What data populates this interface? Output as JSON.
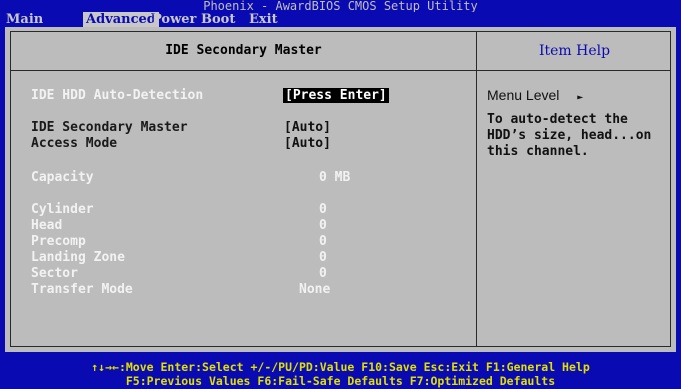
{
  "title": "Phoenix - AwardBIOS CMOS Setup Utility",
  "menu": [
    "Main",
    "Advanced",
    "Power",
    "Boot",
    "Exit"
  ],
  "panel_title": "IDE Secondary Master",
  "help_title": "Item Help",
  "fields": {
    "auto_detect": {
      "label": "IDE HDD Auto-Detection",
      "value": "[Press Enter]"
    },
    "secondary_master": {
      "label": "IDE Secondary Master",
      "value": "[Auto]"
    },
    "access_mode": {
      "label": "Access Mode",
      "value": "[Auto]"
    },
    "capacity": {
      "label": "Capacity",
      "value": "0 MB"
    },
    "cylinder": {
      "label": "Cylinder",
      "value": "0"
    },
    "head": {
      "label": "Head",
      "value": "0"
    },
    "precomp": {
      "label": "Precomp",
      "value": "0"
    },
    "landing_zone": {
      "label": "Landing Zone",
      "value": "0"
    },
    "sector": {
      "label": "Sector",
      "value": "0"
    },
    "transfer_mode": {
      "label": "Transfer Mode",
      "value": "None"
    }
  },
  "help": {
    "menu_level": "Menu Level",
    "menu_level_arrow": "►",
    "line1": "To auto-detect the",
    "line2": "HDD’s size, head...on",
    "line3": "this channel."
  },
  "footer": {
    "line1": "↑↓→←:Move  Enter:Select  +/-/PU/PD:Value  F10:Save  Esc:Exit  F1:General Help",
    "line2": "F5:Previous Values  F6:Fail-Safe Defaults F7:Optimized Defaults"
  },
  "colors": {
    "background": "#0a0ab2",
    "panel": "#bcbcbc",
    "footer_text": "#e0e000"
  }
}
